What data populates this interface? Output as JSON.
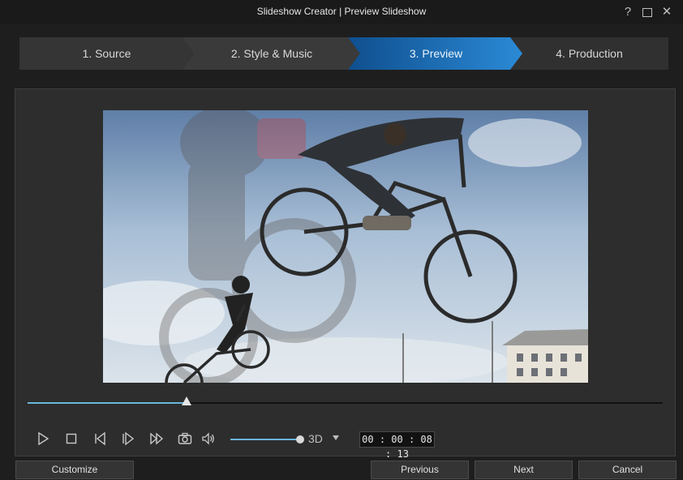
{
  "window": {
    "title": "Slideshow Creator | Preview Slideshow",
    "help_glyph": "?",
    "close_glyph": "✕"
  },
  "steps": [
    {
      "label": "1. Source",
      "active": false
    },
    {
      "label": "2. Style & Music",
      "active": false
    },
    {
      "label": "3. Preview",
      "active": true
    },
    {
      "label": "4. Production",
      "active": false
    }
  ],
  "colors": {
    "accent": "#6ab6dc",
    "active_step": "#1c6db5",
    "inactive_step": "#3a3a3a"
  },
  "player": {
    "progress_fraction": 0.25,
    "volume_fraction": 1.0,
    "mode": "3D",
    "timecode": "00 : 00 : 08 : 13",
    "icons": [
      "play-icon",
      "stop-icon",
      "previous-frame-icon",
      "next-frame-icon",
      "fast-forward-icon",
      "snapshot-camera-icon",
      "volume-icon"
    ]
  },
  "footer": {
    "customize": "Customize",
    "previous": "Previous",
    "next": "Next",
    "cancel": "Cancel"
  }
}
